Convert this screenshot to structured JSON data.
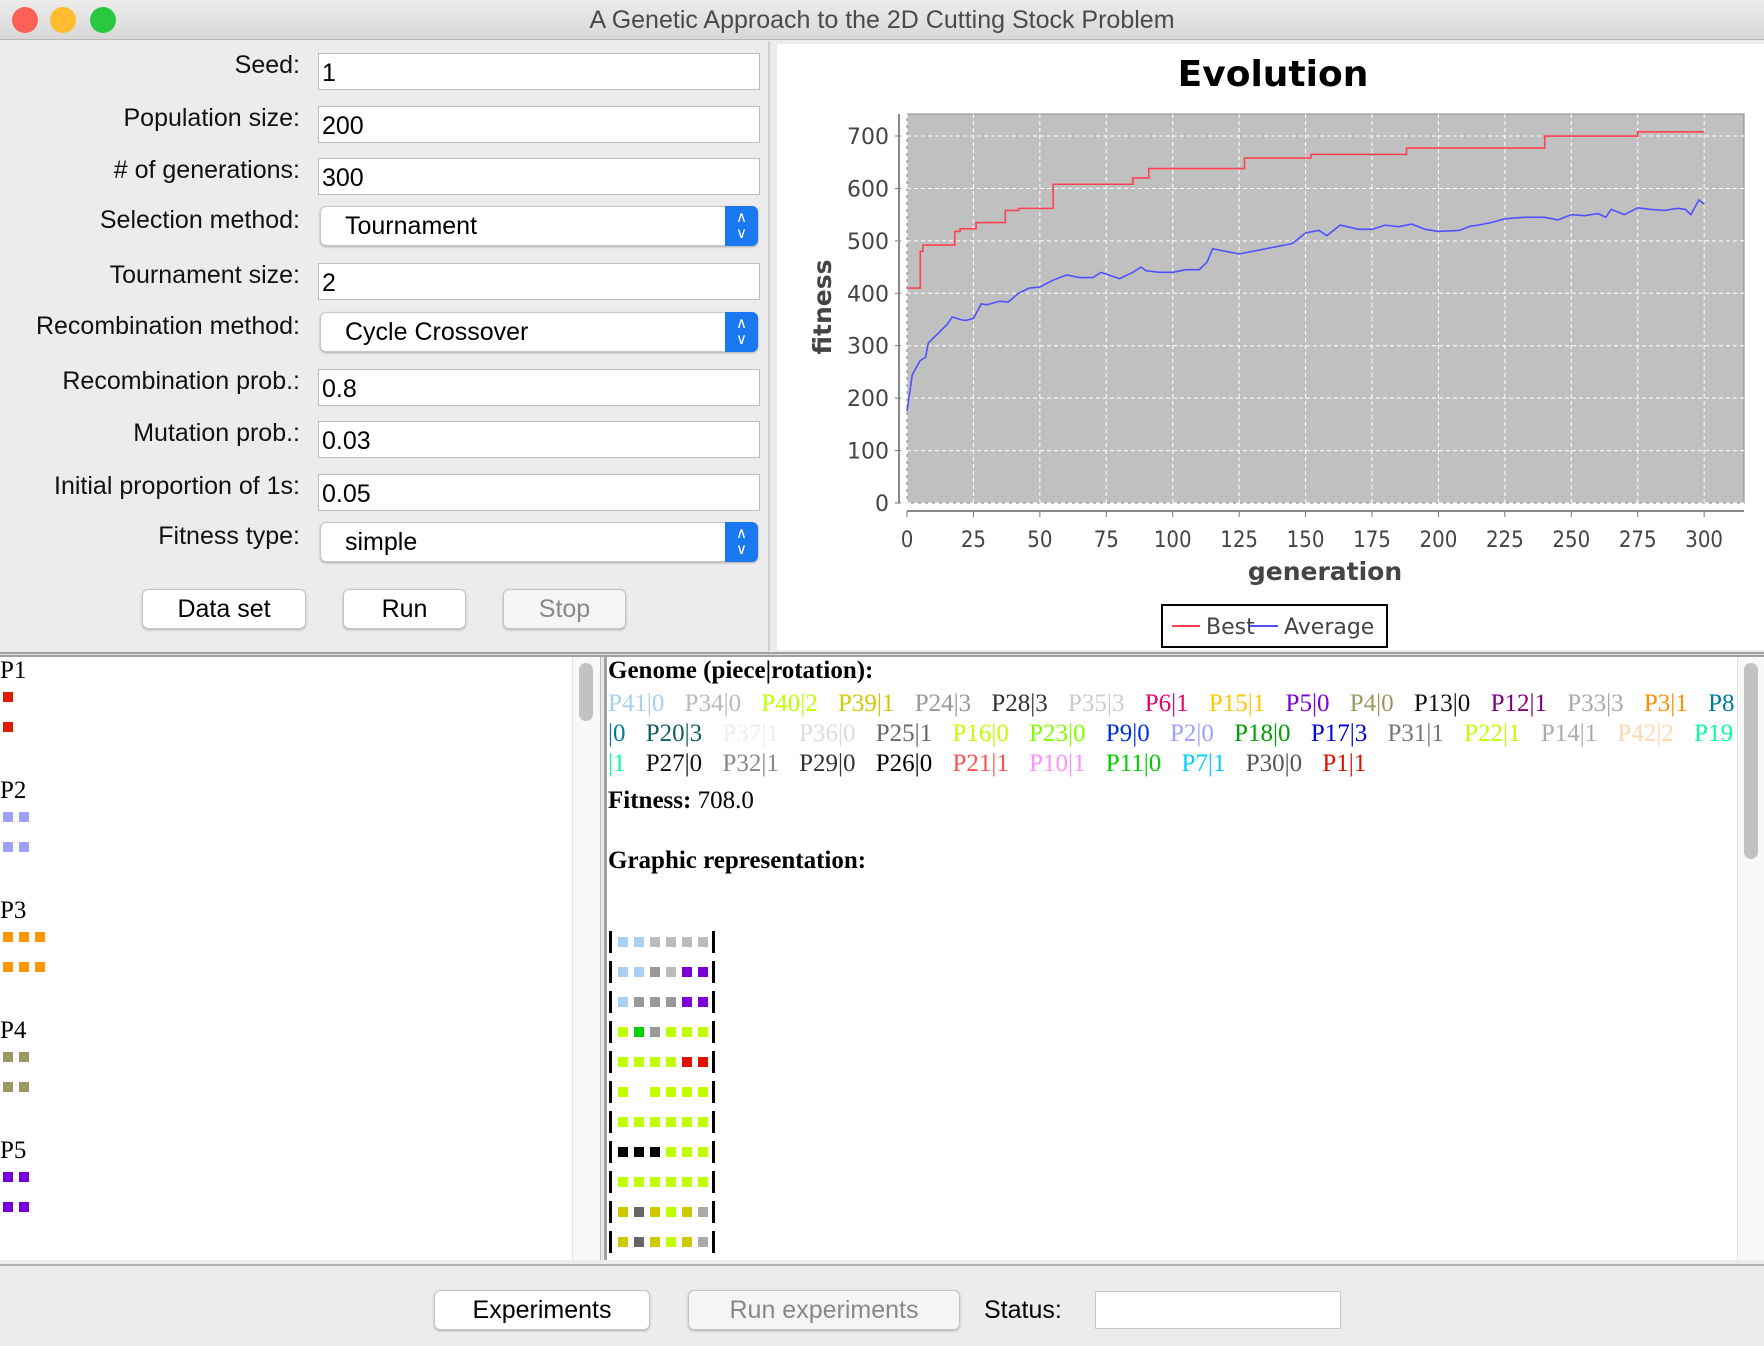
{
  "window": {
    "title": "A Genetic Approach to the 2D Cutting Stock Problem",
    "traffic": [
      "#fe5f57",
      "#febc2e",
      "#28c840"
    ]
  },
  "form": {
    "fields": [
      {
        "label": "Seed:",
        "value": "1",
        "type": "text"
      },
      {
        "label": "Population size:",
        "value": "200",
        "type": "text"
      },
      {
        "label": "# of generations:",
        "value": "300",
        "type": "text"
      },
      {
        "label": "Selection method:",
        "value": "Tournament",
        "type": "select"
      },
      {
        "label": "Tournament size:",
        "value": "2",
        "type": "text"
      },
      {
        "label": "Recombination method:",
        "value": "Cycle Crossover",
        "type": "select"
      },
      {
        "label": "Recombination prob.:",
        "value": "0.8",
        "type": "text"
      },
      {
        "label": "Mutation prob.:",
        "value": "0.03",
        "type": "text"
      },
      {
        "label": "Initial proportion of 1s:",
        "value": "0.05",
        "type": "text"
      },
      {
        "label": "Fitness type:",
        "value": "simple",
        "type": "select"
      }
    ],
    "buttons": {
      "data_set": "Data set",
      "run": "Run",
      "stop": "Stop"
    }
  },
  "chart_data": {
    "type": "line",
    "title": "Evolution",
    "xlabel": "generation",
    "ylabel": "fitness",
    "xlim": [
      0,
      315
    ],
    "ylim": [
      0,
      742
    ],
    "xticks": [
      0,
      25,
      50,
      75,
      100,
      125,
      150,
      175,
      200,
      225,
      250,
      275,
      300
    ],
    "yticks": [
      0,
      100,
      200,
      300,
      400,
      500,
      600,
      700
    ],
    "grid": true,
    "legend_placement": "bottom",
    "plot_background": "#c0c0c0",
    "series": [
      {
        "name": "Best",
        "color": "#ff4050",
        "step": true,
        "x": [
          0,
          5,
          6,
          18,
          20,
          26,
          37,
          42,
          55,
          85,
          91,
          127,
          152,
          188,
          240,
          275,
          300
        ],
        "y": [
          410,
          480,
          492,
          518,
          523,
          535,
          558,
          562,
          608,
          620,
          638,
          658,
          665,
          677,
          700,
          708,
          708
        ]
      },
      {
        "name": "Average",
        "color": "#5050ff",
        "step": false,
        "x": [
          0,
          2,
          5,
          7,
          8,
          12,
          15,
          17,
          20,
          22,
          25,
          28,
          30,
          35,
          38,
          42,
          46,
          50,
          55,
          60,
          65,
          70,
          73,
          77,
          80,
          85,
          88,
          90,
          95,
          100,
          105,
          110,
          113,
          115,
          120,
          125,
          130,
          135,
          140,
          145,
          150,
          155,
          158,
          163,
          170,
          175,
          180,
          185,
          190,
          195,
          200,
          208,
          212,
          215,
          220,
          225,
          232,
          240,
          245,
          250,
          255,
          260,
          263,
          265,
          270,
          275,
          280,
          285,
          290,
          293,
          295,
          298,
          300
        ],
        "y": [
          175,
          245,
          272,
          278,
          305,
          325,
          340,
          355,
          350,
          348,
          352,
          380,
          378,
          385,
          383,
          400,
          410,
          412,
          425,
          435,
          430,
          430,
          440,
          433,
          428,
          440,
          450,
          443,
          440,
          440,
          445,
          445,
          460,
          485,
          480,
          475,
          480,
          485,
          490,
          495,
          515,
          520,
          510,
          530,
          522,
          522,
          530,
          527,
          532,
          522,
          518,
          520,
          528,
          530,
          535,
          542,
          545,
          545,
          540,
          550,
          548,
          552,
          545,
          560,
          550,
          563,
          560,
          558,
          562,
          560,
          550,
          578,
          570
        ]
      }
    ]
  },
  "pieces": [
    {
      "label": "P1",
      "color": "#e21b00",
      "cols": 1
    },
    {
      "label": "P2",
      "color": "#a0a0ff",
      "cols": 2
    },
    {
      "label": "P3",
      "color": "#ff9600",
      "cols": 3
    },
    {
      "label": "P4",
      "color": "#9a9a60",
      "cols": 2
    },
    {
      "label": "P5",
      "color": "#7800d6",
      "cols": 2
    }
  ],
  "result": {
    "genome_label": "Genome (piece|rotation):",
    "genome": [
      {
        "t": "P41|0",
        "c": "#a8d0f5"
      },
      {
        "t": "P34|0",
        "c": "#bbbbbb"
      },
      {
        "t": "P40|2",
        "c": "#c0ff00"
      },
      {
        "t": "P39|1",
        "c": "#d0c800"
      },
      {
        "t": "P24|3",
        "c": "#999999"
      },
      {
        "t": "P28|3",
        "c": "#333333"
      },
      {
        "t": "P35|3",
        "c": "#cccccc"
      },
      {
        "t": "P6|1",
        "c": "#e8006e"
      },
      {
        "t": "P15|1",
        "c": "#ffc800"
      },
      {
        "t": "P5|0",
        "c": "#7a00d8"
      },
      {
        "t": "P4|0",
        "c": "#9a9a60"
      },
      {
        "t": "P13|0",
        "c": "#111111"
      },
      {
        "t": "P12|1",
        "c": "#800080"
      },
      {
        "t": "P33|3",
        "c": "#aaaaaa"
      },
      {
        "t": "P3|1",
        "c": "#ff9000"
      },
      {
        "t": "P8|0",
        "c": "#007aa0"
      },
      {
        "t": "P20|3",
        "c": "#106060"
      },
      {
        "t": "P37|1",
        "c": "#eeeeee"
      },
      {
        "t": "P36|0",
        "c": "#dddddd"
      },
      {
        "t": "P25|1",
        "c": "#666666"
      },
      {
        "t": "P16|0",
        "c": "#c0ff00"
      },
      {
        "t": "P23|0",
        "c": "#80ff00"
      },
      {
        "t": "P9|0",
        "c": "#0030e0"
      },
      {
        "t": "P2|0",
        "c": "#a0a0ff"
      },
      {
        "t": "P18|0",
        "c": "#00a000"
      },
      {
        "t": "P17|3",
        "c": "#0000e0"
      },
      {
        "t": "P31|1",
        "c": "#777777"
      },
      {
        "t": "P22|1",
        "c": "#c0ff00"
      },
      {
        "t": "P14|1",
        "c": "#aaaaaa"
      },
      {
        "t": "P42|2",
        "c": "#ffd8b0"
      },
      {
        "t": "P19|1",
        "c": "#00ffa0"
      },
      {
        "t": "P27|0",
        "c": "#111111"
      },
      {
        "t": "P32|1",
        "c": "#888888"
      },
      {
        "t": "P29|0",
        "c": "#333333"
      },
      {
        "t": "P26|0",
        "c": "#000000"
      },
      {
        "t": "P21|1",
        "c": "#ff5050"
      },
      {
        "t": "P10|1",
        "c": "#ff90ff"
      },
      {
        "t": "P11|0",
        "c": "#00d000"
      },
      {
        "t": "P7|1",
        "c": "#00d0ff"
      },
      {
        "t": "P30|0",
        "c": "#555555"
      },
      {
        "t": "P1|1",
        "c": "#e01000"
      }
    ],
    "fitness_label": "Fitness:",
    "fitness_value": "708.0",
    "graphic_label": "Graphic representation:",
    "grid": [
      [
        "#a8d0f5",
        "#a8d0f5",
        "#bbbbbb",
        "#bbbbbb",
        "#bbbbbb",
        "#bbbbbb"
      ],
      [
        "#a8d0f5",
        "#a8d0f5",
        "#999999",
        "#bbbbbb",
        "#7a00d8",
        "#7a00d8"
      ],
      [
        "#a8d0f5",
        "#999999",
        "#999999",
        "#999999",
        "#7a00d8",
        "#7a00d8"
      ],
      [
        "#c0ff00",
        "#00d000",
        "#999999",
        "#c0ff00",
        "#c0ff00",
        "#c0ff00"
      ],
      [
        "#c0ff00",
        "#c0ff00",
        "#c0ff00",
        "#c0ff00",
        "#e01000",
        "#e01000"
      ],
      [
        "#c0ff00",
        "",
        "#c0ff00",
        "#c0ff00",
        "#c0ff00",
        "#c0ff00"
      ],
      [
        "#c0ff00",
        "#c0ff00",
        "#c0ff00",
        "#c0ff00",
        "#c0ff00",
        "#c0ff00"
      ],
      [
        "#000000",
        "#000000",
        "#000000",
        "#c0ff00",
        "#c0ff00",
        "#c0ff00"
      ],
      [
        "#c0ff00",
        "#c0ff00",
        "#c0ff00",
        "#c0ff00",
        "#c0ff00",
        "#c0ff00"
      ],
      [
        "#d0c800",
        "#666666",
        "#d0c800",
        "#c0ff00",
        "#d0c800",
        "#aaaaaa"
      ],
      [
        "#d0c800",
        "#666666",
        "#d0c800",
        "#c0ff00",
        "#d0c800",
        "#aaaaaa"
      ]
    ]
  },
  "bottom": {
    "experiments": "Experiments",
    "run_experiments": "Run experiments",
    "status_label": "Status:",
    "status_value": ""
  }
}
